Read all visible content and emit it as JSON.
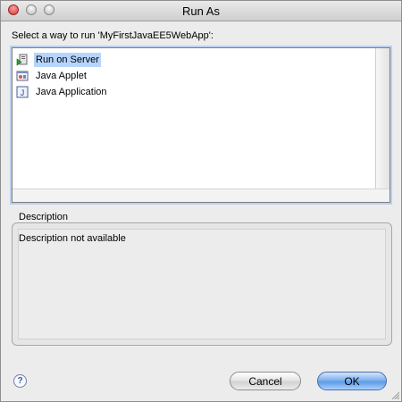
{
  "window": {
    "title": "Run As"
  },
  "prompt": "Select a way to run 'MyFirstJavaEE5WebApp':",
  "launch_options": [
    {
      "label": "Run on Server",
      "icon": "run-on-server-icon",
      "selected": true
    },
    {
      "label": "Java Applet",
      "icon": "java-applet-icon",
      "selected": false
    },
    {
      "label": "Java Application",
      "icon": "java-application-icon",
      "selected": false
    }
  ],
  "description": {
    "label": "Description",
    "text": "Description not available"
  },
  "buttons": {
    "help_icon": "help-icon",
    "cancel": "Cancel",
    "ok": "OK"
  },
  "colors": {
    "selection": "#b5d5ff",
    "ok_button": "#5d9be6",
    "focus_ring": "#b9cfee"
  }
}
